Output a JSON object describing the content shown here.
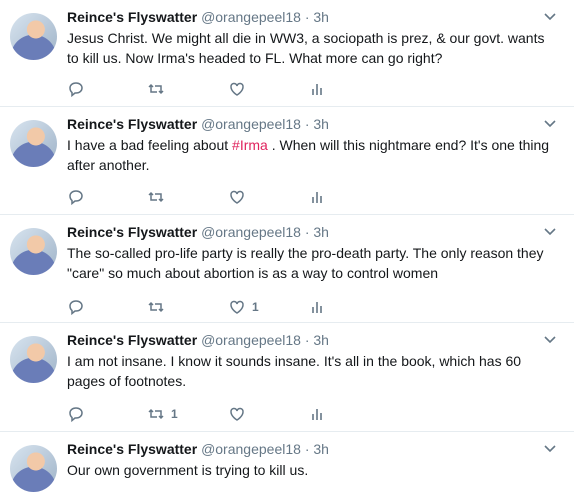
{
  "tweets": [
    {
      "name": "Reince's Flyswatter",
      "handle": "@orangepeel18",
      "time": "· 3h",
      "text_before": "Jesus Christ. We might all die in WW3, a sociopath is prez, & our govt. wants to kill us. Now Irma's headed to FL. What more can go right?",
      "hashtag": "",
      "text_after": "",
      "retweets": "",
      "likes": ""
    },
    {
      "name": "Reince's Flyswatter",
      "handle": "@orangepeel18",
      "time": "· 3h",
      "text_before": "I have a bad feeling about ",
      "hashtag": "#Irma",
      "text_after": " . When will this nightmare end?  It's one thing after another.",
      "retweets": "",
      "likes": ""
    },
    {
      "name": "Reince's Flyswatter",
      "handle": "@orangepeel18",
      "time": "· 3h",
      "text_before": "The so-called pro-life party is really the pro-death party. The only reason they \"care\" so much about abortion is as a way to control women",
      "hashtag": "",
      "text_after": "",
      "retweets": "",
      "likes": "1"
    },
    {
      "name": "Reince's Flyswatter",
      "handle": "@orangepeel18",
      "time": "· 3h",
      "text_before": "I am not insane. I know it sounds insane.   It's all in the book, which has 60 pages of footnotes.",
      "hashtag": "",
      "text_after": "",
      "retweets": "1",
      "likes": ""
    },
    {
      "name": "Reince's Flyswatter",
      "handle": "@orangepeel18",
      "time": "· 3h",
      "text_before": "Our own government is trying to kill us.",
      "hashtag": "",
      "text_after": "",
      "retweets": "",
      "likes": ""
    }
  ],
  "icons": {
    "reply": "reply-icon",
    "retweet": "retweet-icon",
    "like": "heart-icon",
    "analytics": "analytics-icon",
    "caret": "chevron-down-icon"
  },
  "colors": {
    "hashtag": "#e0245e",
    "muted": "#657786",
    "divider": "#e6ecf0"
  }
}
